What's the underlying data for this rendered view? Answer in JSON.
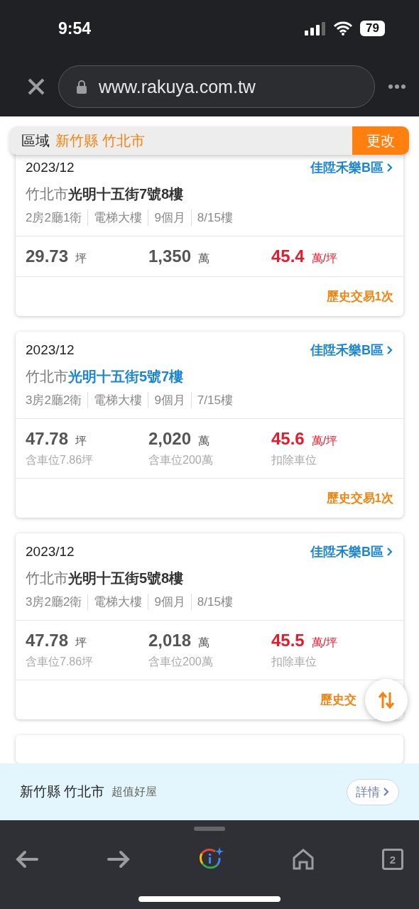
{
  "status_bar": {
    "time": "9:54",
    "battery": "79"
  },
  "browser": {
    "url": "www.rakuya.com.tw"
  },
  "region_bar": {
    "label": "區域",
    "county": "新竹縣",
    "city": "竹北市",
    "button": "更改"
  },
  "cards": [
    {
      "date": "2023/12",
      "community": "佳陞禾樂B區",
      "district": "竹北市",
      "address": "光明十五街7號8樓",
      "visited": false,
      "tags": [
        "2房2廳1衛",
        "電梯大樓",
        "9個月",
        "8/15樓"
      ],
      "area": "29.73",
      "area_unit": "坪",
      "price": "1,350",
      "price_unit": "萬",
      "unit_price": "45.4",
      "unit_price_unit": "萬/坪",
      "history": "歷史交易1次"
    },
    {
      "date": "2023/12",
      "community": "佳陞禾樂B區",
      "district": "竹北市",
      "address": "光明十五街5號7樓",
      "visited": true,
      "tags": [
        "3房2廳2衛",
        "電梯大樓",
        "9個月",
        "7/15樓"
      ],
      "area": "47.78",
      "area_unit": "坪",
      "price": "2,020",
      "price_unit": "萬",
      "unit_price": "45.6",
      "unit_price_unit": "萬/坪",
      "notes": [
        "含車位7.86坪",
        "含車位200萬",
        "扣除車位"
      ],
      "history": "歷史交易1次"
    },
    {
      "date": "2023/12",
      "community": "佳陞禾樂B區",
      "district": "竹北市",
      "address": "光明十五街5號8樓",
      "visited": false,
      "tags": [
        "3房2廳2衛",
        "電梯大樓",
        "9個月",
        "8/15樓"
      ],
      "area": "47.78",
      "area_unit": "坪",
      "price": "2,018",
      "price_unit": "萬",
      "unit_price": "45.5",
      "unit_price_unit": "萬/坪",
      "notes": [
        "含車位7.86坪",
        "含車位200萬",
        "扣除車位"
      ],
      "history": "歷史交"
    }
  ],
  "banner": {
    "place": "新竹縣 竹北市",
    "tagline": "超值好屋",
    "button": "詳情"
  },
  "toolbar": {
    "tabs_count": "2"
  }
}
